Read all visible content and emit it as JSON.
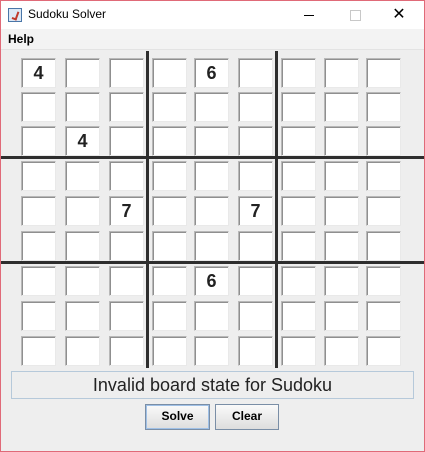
{
  "window": {
    "title": "Sudoku Solver",
    "minimize_label": "",
    "maximize_label": "",
    "close_label": "✕"
  },
  "menu": {
    "items": [
      {
        "label": "Help"
      }
    ]
  },
  "board": {
    "cells": [
      [
        "4",
        "",
        "",
        "",
        "6",
        "",
        "",
        "",
        ""
      ],
      [
        "",
        "",
        "",
        "",
        "",
        "",
        "",
        "",
        ""
      ],
      [
        "",
        "4",
        "",
        "",
        "",
        "",
        "",
        "",
        ""
      ],
      [
        "",
        "",
        "",
        "",
        "",
        "",
        "",
        "",
        ""
      ],
      [
        "",
        "",
        "7",
        "",
        "",
        "7",
        "",
        "",
        ""
      ],
      [
        "",
        "",
        "",
        "",
        "",
        "",
        "",
        "",
        ""
      ],
      [
        "",
        "",
        "",
        "",
        "6",
        "",
        "",
        "",
        ""
      ],
      [
        "",
        "",
        "",
        "",
        "",
        "",
        "",
        "",
        ""
      ],
      [
        "",
        "",
        "",
        "",
        "",
        "",
        "",
        "",
        ""
      ]
    ]
  },
  "status": {
    "message": "Invalid board state for Sudoku"
  },
  "buttons": {
    "solve_label": "Solve",
    "clear_label": "Clear"
  }
}
